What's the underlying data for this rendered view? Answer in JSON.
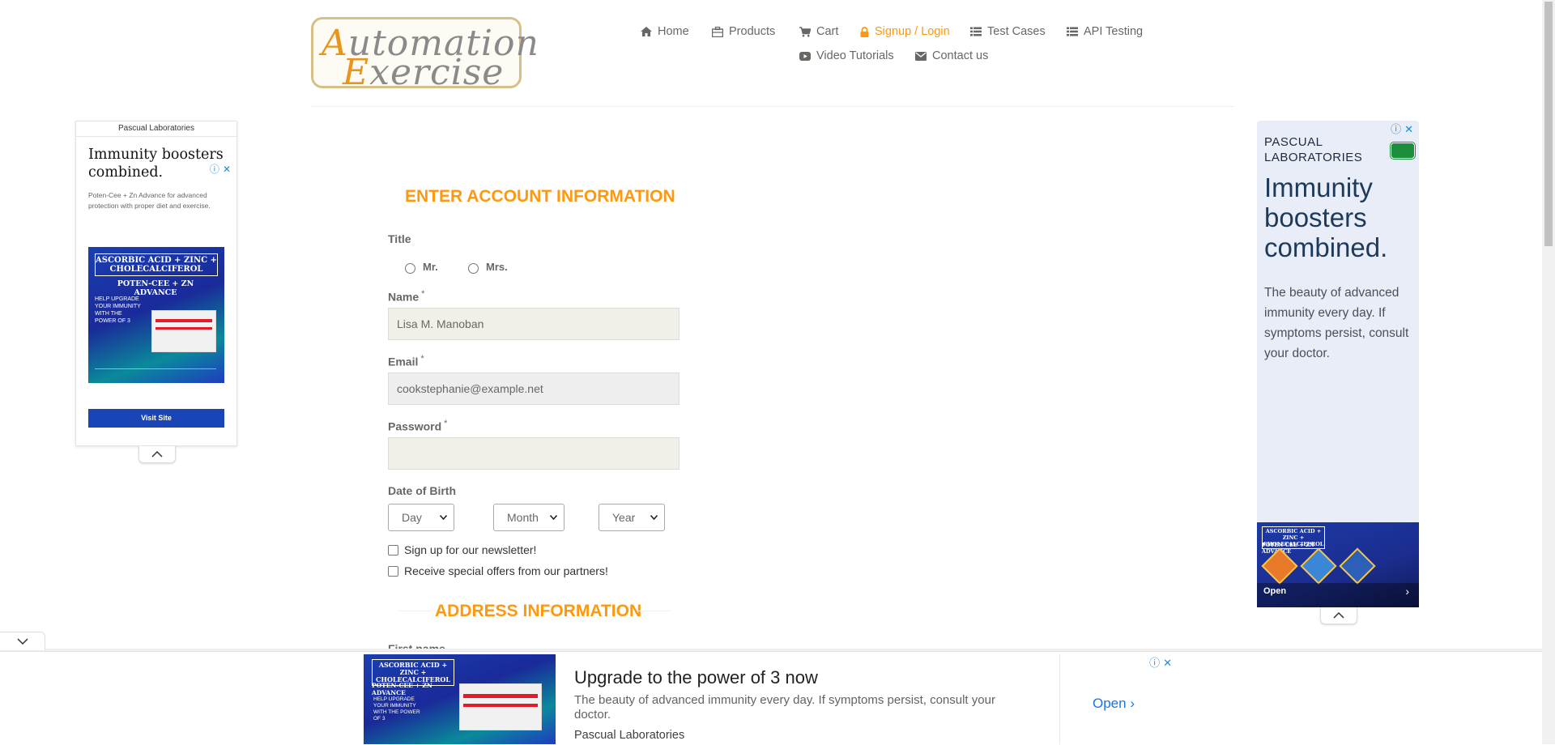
{
  "header": {
    "logo": {
      "word1": "Automation",
      "word2": "Exercise"
    },
    "nav": [
      {
        "label": "Home",
        "icon": "home-icon"
      },
      {
        "label": "Products",
        "icon": "products-icon"
      },
      {
        "label": "Cart",
        "icon": "cart-icon"
      },
      {
        "label": "Signup / Login",
        "icon": "lock-icon",
        "active": true
      },
      {
        "label": "Test Cases",
        "icon": "list-icon"
      },
      {
        "label": "API Testing",
        "icon": "list-icon"
      },
      {
        "label": "Video Tutorials",
        "icon": "youtube-icon"
      },
      {
        "label": "Contact us",
        "icon": "envelope-icon"
      }
    ]
  },
  "form": {
    "section_title": "ENTER ACCOUNT INFORMATION",
    "title_label": "Title",
    "title_options": [
      "Mr.",
      "Mrs."
    ],
    "name_label": "Name",
    "name_value": "Lisa M. Manoban",
    "email_label": "Email",
    "email_value": "cookstephanie@example.net",
    "password_label": "Password",
    "password_value": "",
    "required_mark": "*",
    "dob_label": "Date of Birth",
    "dob_day": "Day",
    "dob_month": "Month",
    "dob_year": "Year",
    "newsletter_label": "Sign up for our newsletter!",
    "offers_label": "Receive special offers from our partners!",
    "address_title": "ADDRESS INFORMATION",
    "next_label_partial": "First name"
  },
  "ad_left": {
    "sponsor": "Pascual Laboratories",
    "headline": "Immunity boosters combined.",
    "body": "Poten-Cee + Zn Advance for advanced protection with proper diet and exercise.",
    "product_title": "ASCORBIC ACID + ZINC + CHOLECALCIFEROL",
    "product_subtitle": "POTEN-CEE + ZN ADVANCE",
    "product_tagline": "HELP UPGRADE YOUR IMMUNITY WITH THE POWER OF 3",
    "cta": "Visit Site"
  },
  "ad_right": {
    "brand": "PASCUAL LABORATORIES",
    "headline": "Immunity boosters combined.",
    "body": "The beauty of advanced immunity every day. If symptoms persist, consult your doctor.",
    "product_title": "ASCORBIC ACID + ZINC + CHOLECALCIFEROL",
    "product_subtitle": "POTEN-CEE + ZN ADVANCE",
    "open": "Open"
  },
  "ad_bottom": {
    "product_title": "ASCORBIC ACID + ZINC + CHOLECALCIFEROL",
    "product_subtitle": "POTEN-CEE + ZN ADVANCE",
    "product_tagline": "HELP UPGRADE YOUR IMMUNITY WITH THE POWER OF 3",
    "headline": "Upgrade to the power of 3 now",
    "body": "The beauty of advanced immunity every day. If symptoms persist, consult your doctor.",
    "sponsor": "Pascual Laboratories",
    "open": "Open"
  },
  "colors": {
    "accent": "#fe980f",
    "text": "#696763",
    "ad_blue": "#1a45b6"
  }
}
